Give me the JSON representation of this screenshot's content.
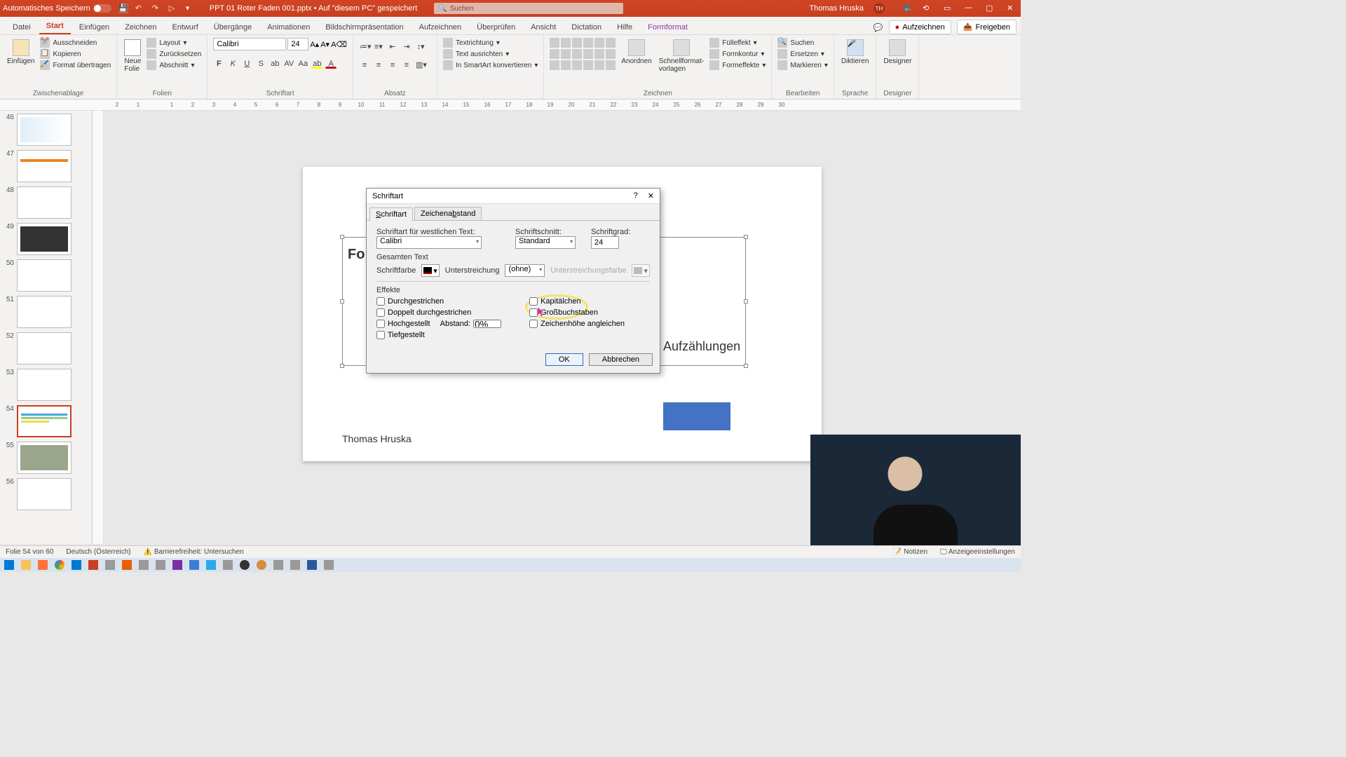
{
  "titlebar": {
    "autosave": "Automatisches Speichern",
    "docname": "PPT 01 Roter Faden 001.pptx • Auf \"diesem PC\" gespeichert",
    "search_placeholder": "Suchen",
    "username": "Thomas Hruska",
    "initials": "TH"
  },
  "tabs": {
    "items": [
      "Datei",
      "Start",
      "Einfügen",
      "Zeichnen",
      "Entwurf",
      "Übergänge",
      "Animationen",
      "Bildschirmpräsentation",
      "Aufzeichnen",
      "Überprüfen",
      "Ansicht",
      "Dictation",
      "Hilfe",
      "Formformat"
    ],
    "active_index": 1,
    "record": "Aufzeichnen",
    "share": "Freigeben"
  },
  "ribbon": {
    "group1": {
      "label": "Zwischenablage",
      "paste": "Einfügen",
      "cut": "Ausschneiden",
      "copy": "Kopieren",
      "fmtpaint": "Format übertragen"
    },
    "group2": {
      "label": "Folien",
      "newslide": "Neue\nFolie",
      "layout": "Layout",
      "reset": "Zurücksetzen",
      "section": "Abschnitt"
    },
    "group3": {
      "label": "Schriftart",
      "fontname": "Calibri",
      "fontsize": "24"
    },
    "group4": {
      "label": "Absatz"
    },
    "group5": {
      "label": "Zeichnen",
      "arrange": "Anordnen",
      "quickformat": "Schnellformat-\nvorlagen",
      "textdir": "Textrichtung",
      "aligntext": "Text ausrichten",
      "smartart": "In SmartArt konvertieren",
      "filleffect": "Fülleffekt",
      "contour": "Formkontur",
      "effects": "Formeffekte"
    },
    "group6": {
      "label": "Bearbeiten",
      "find": "Suchen",
      "replace": "Ersetzen",
      "select": "Markieren"
    },
    "group7": {
      "label": "Sprache",
      "dictate": "Diktieren"
    },
    "group8": {
      "label": "Designer",
      "designer": "Designer"
    }
  },
  "thumbs": [
    {
      "num": "46"
    },
    {
      "num": "47"
    },
    {
      "num": "48"
    },
    {
      "num": "49"
    },
    {
      "num": "50"
    },
    {
      "num": "51"
    },
    {
      "num": "52"
    },
    {
      "num": "53"
    },
    {
      "num": "54",
      "selected": true
    },
    {
      "num": "55"
    },
    {
      "num": "56"
    }
  ],
  "ruler_marks": [
    "2",
    "1",
    "1",
    "2",
    "3",
    "4",
    "5",
    "6",
    "7",
    "8",
    "9",
    "10",
    "11",
    "12",
    "13",
    "14",
    "15",
    "16",
    "17",
    "18",
    "19",
    "20",
    "21",
    "22",
    "23",
    "24",
    "25",
    "26",
    "27",
    "28",
    "29",
    "30"
  ],
  "slide": {
    "title_glimpse_left": "Fo",
    "title_glimpse_right": "d Aufzählungen",
    "title_glimpse_right2": ")",
    "author": "Thomas Hruska"
  },
  "dialog": {
    "title": "Schriftart",
    "tab_font": "Schriftart",
    "tab_spacing": "Zeichenabstand",
    "lbl_fontwest": "Schriftart für westlichen Text:",
    "val_fontwest": "Calibri",
    "lbl_style": "Schriftschnitt:",
    "val_style": "Standard",
    "lbl_size": "Schriftgrad:",
    "val_size": "24",
    "section_all": "Gesamten Text",
    "lbl_color": "Schriftfarbe",
    "lbl_underline": "Unterstreichung",
    "val_underline": "(ohne)",
    "lbl_ulcolor": "Unterstreichungsfarbe",
    "section_effects": "Effekte",
    "eff_strike": "Durchgestrichen",
    "eff_dstrike": "Doppelt durchgestrichen",
    "eff_super": "Hochgestellt",
    "eff_sub": "Tiefgestellt",
    "lbl_offset": "Abstand:",
    "val_offset": "0%",
    "eff_smallcaps": "Kapitälchen",
    "eff_allcaps": "Großbuchstaben",
    "eff_equalize": "Zeichenhöhe angleichen",
    "btn_ok": "OK",
    "btn_cancel": "Abbrechen"
  },
  "statusbar": {
    "slidecount": "Folie 54 von 60",
    "lang": "Deutsch (Österreich)",
    "accessibility": "Barrierefreiheit: Untersuchen",
    "notes": "Notizen",
    "display": "Anzeigeeinstellungen"
  }
}
